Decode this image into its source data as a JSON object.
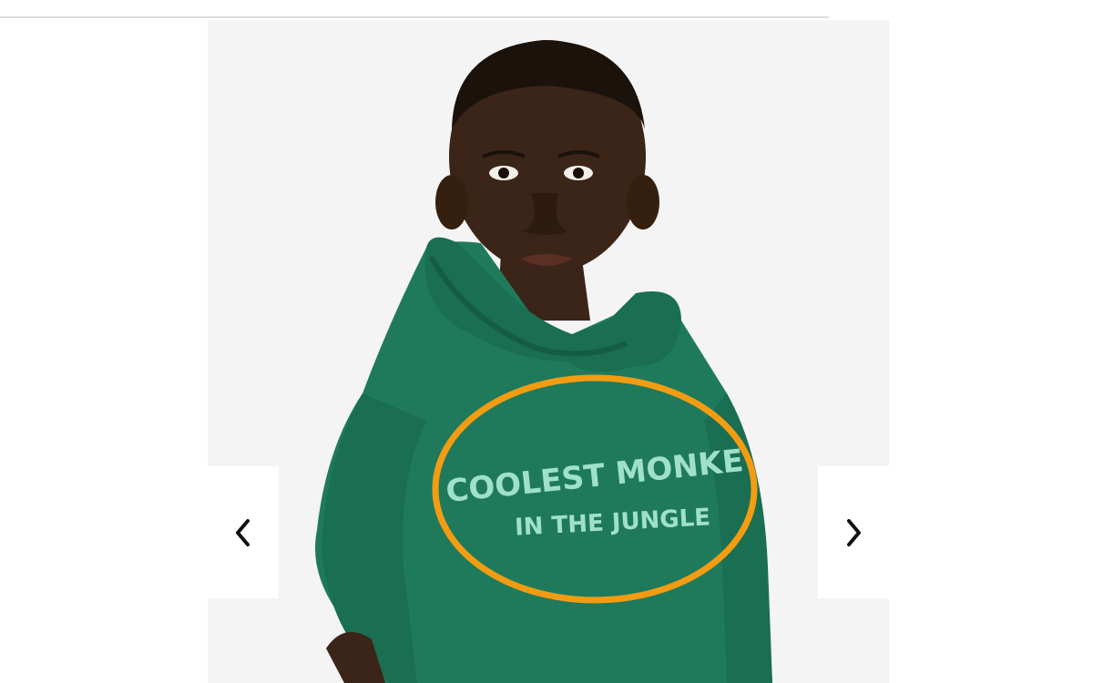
{
  "gallery": {
    "photo_icon": "child-model-green-hoodie",
    "hoodie_print": {
      "line1": "COOLEST MONKE",
      "line2": "IN THE JUNGLE"
    },
    "highlight_color": "#f39c12",
    "prev_icon": "chevron-left-icon",
    "next_icon": "chevron-right-icon"
  },
  "colors": {
    "hoodie": "#1f7a5c",
    "background": "#f4f4f4",
    "highlight": "#f39c12"
  }
}
